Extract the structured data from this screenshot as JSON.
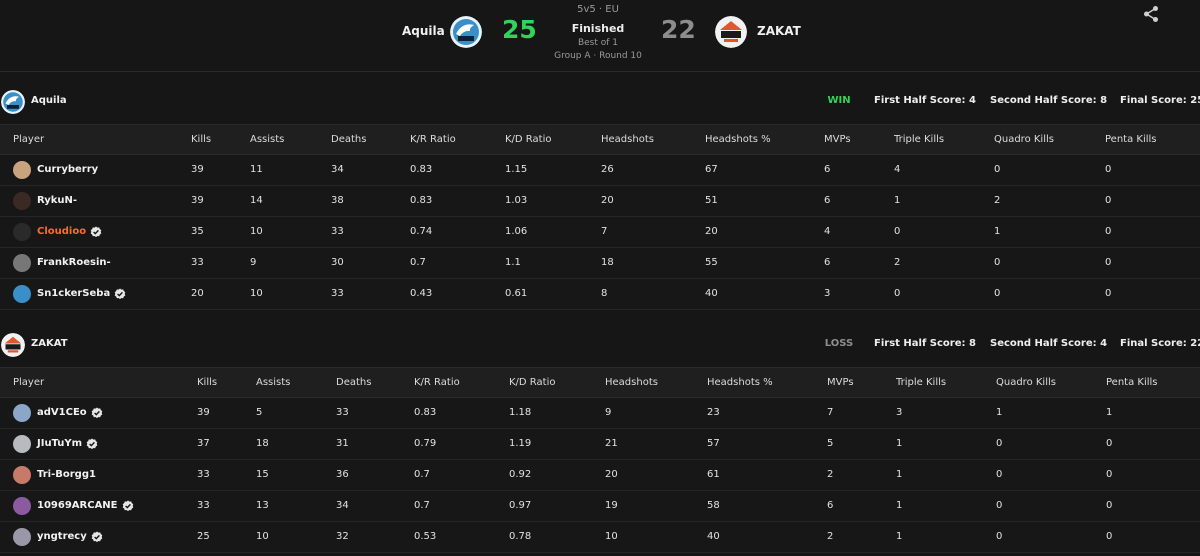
{
  "match": {
    "format": "5v5 · EU",
    "status": "Finished",
    "best_of": "Best of 1",
    "group_round": "Group A · Round 10",
    "team1": {
      "name": "Aquila",
      "score": "25"
    },
    "team2": {
      "name": "ZAKAT",
      "score": "22"
    },
    "share_icon": "share-icon"
  },
  "colors": {
    "win": "#32d35a",
    "loss": "#8d8d8d",
    "highlight_player": "#ff6b2c",
    "background": "#161616"
  },
  "columns_team1": [
    "Player",
    "Kills",
    "Assists",
    "Deaths",
    "K/R Ratio",
    "K/D Ratio",
    "Headshots",
    "Headshots %",
    "MVPs",
    "Triple Kills",
    "Quadro Kills",
    "Penta Kills"
  ],
  "columns_team2": [
    "Player",
    "Kills",
    "Assists",
    "Deaths",
    "K/R Ratio",
    "K/D Ratio",
    "Headshots",
    "Headshots %",
    "MVPs",
    "Triple Kills",
    "Quadro Kills",
    "Penta Kills"
  ],
  "teams": [
    {
      "name": "Aquila",
      "result": "WIN",
      "first_half": "First Half Score: 4",
      "second_half": "Second Half Score: 8",
      "final": "Final Score: 25",
      "players": [
        {
          "name": "Curryberry",
          "verified": false,
          "highlight": false,
          "stats": [
            "39",
            "11",
            "34",
            "0.83",
            "1.15",
            "26",
            "67",
            "6",
            "4",
            "0",
            "0"
          ]
        },
        {
          "name": "RykuN-",
          "verified": false,
          "highlight": false,
          "stats": [
            "39",
            "14",
            "38",
            "0.83",
            "1.03",
            "20",
            "51",
            "6",
            "1",
            "2",
            "0"
          ]
        },
        {
          "name": "Cloudioo",
          "verified": true,
          "highlight": true,
          "stats": [
            "35",
            "10",
            "33",
            "0.74",
            "1.06",
            "7",
            "20",
            "4",
            "0",
            "1",
            "0"
          ]
        },
        {
          "name": "FrankRoesin-",
          "verified": false,
          "highlight": false,
          "stats": [
            "33",
            "9",
            "30",
            "0.7",
            "1.1",
            "18",
            "55",
            "6",
            "2",
            "0",
            "0"
          ]
        },
        {
          "name": "Sn1ckerSeba",
          "verified": true,
          "highlight": false,
          "stats": [
            "20",
            "10",
            "33",
            "0.43",
            "0.61",
            "8",
            "40",
            "3",
            "0",
            "0",
            "0"
          ]
        }
      ]
    },
    {
      "name": "ZAKAT",
      "result": "LOSS",
      "first_half": "First Half Score: 8",
      "second_half": "Second Half Score: 4",
      "final": "Final Score: 22",
      "players": [
        {
          "name": "adV1CEo",
          "verified": true,
          "highlight": false,
          "stats": [
            "39",
            "5",
            "33",
            "0.83",
            "1.18",
            "9",
            "23",
            "7",
            "3",
            "1",
            "1"
          ]
        },
        {
          "name": "JIuTuYm",
          "verified": true,
          "highlight": false,
          "stats": [
            "37",
            "18",
            "31",
            "0.79",
            "1.19",
            "21",
            "57",
            "5",
            "1",
            "0",
            "0"
          ]
        },
        {
          "name": "Tri-Borgg1",
          "verified": false,
          "highlight": false,
          "stats": [
            "33",
            "15",
            "36",
            "0.7",
            "0.92",
            "20",
            "61",
            "2",
            "1",
            "0",
            "0"
          ]
        },
        {
          "name": "10969ARCANE",
          "verified": true,
          "highlight": false,
          "stats": [
            "33",
            "13",
            "34",
            "0.7",
            "0.97",
            "19",
            "58",
            "6",
            "1",
            "0",
            "0"
          ]
        },
        {
          "name": "yngtrecy",
          "verified": true,
          "highlight": false,
          "stats": [
            "25",
            "10",
            "32",
            "0.53",
            "0.78",
            "10",
            "40",
            "2",
            "1",
            "0",
            "0"
          ]
        }
      ]
    }
  ]
}
